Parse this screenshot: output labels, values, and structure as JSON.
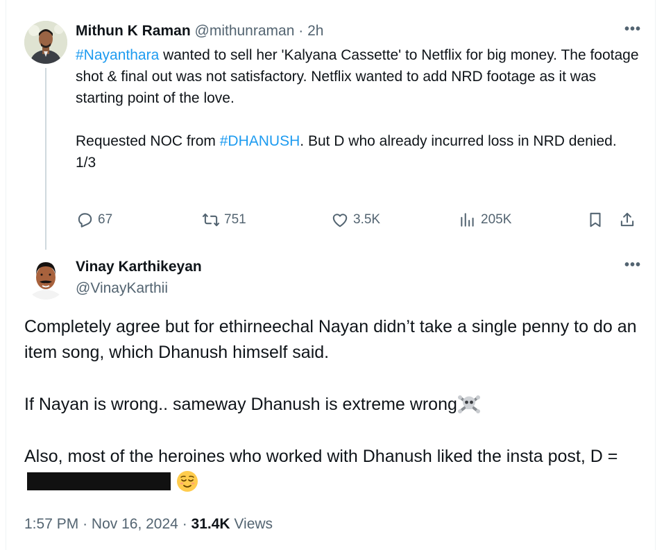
{
  "parent_tweet": {
    "author_name": "Mithun K Raman",
    "author_handle": "@mithunraman",
    "separator": "·",
    "time_ago": "2h",
    "more_label": "•••",
    "line1_hashtag": "#Nayanthara",
    "line1_text": " wanted to sell her 'Kalyana Cassette' to Netflix for big money. The footage shot & final out was not satisfactory. Netflix wanted to add NRD footage as it was starting point of the love.",
    "line2_prefix": "Requested NOC from ",
    "line2_hashtag": "#DHANUSH",
    "line2_text": ". But D who already incurred loss in NRD denied.",
    "line3_text": "1/3",
    "actions": {
      "replies": "67",
      "reposts": "751",
      "likes": "3.5K",
      "views": "205K"
    }
  },
  "main_tweet": {
    "author_name": "Vinay Karthikeyan",
    "author_handle": "@VinayKarthii",
    "more_label": "•••",
    "para1": "Completely agree but for ethirneechal Nayan didn’t take a single penny to do an item song, which Dhanush himself said.",
    "para2": "If Nayan is wrong.. sameway Dhanush is extreme wrong",
    "para2_emoji": "skull-and-crossbones",
    "para3": "Also, most of the heroines who worked with Dhanush liked the insta post, D =",
    "para3_emoji": "relieved-face",
    "time": "1:57 PM",
    "dot": "·",
    "date": "Nov 16, 2024",
    "views_count": "31.4K",
    "views_label": " Views"
  },
  "colors": {
    "link": "#1d9bf0",
    "muted": "#536471",
    "text": "#0f1419",
    "thread_line": "#cfd9de"
  }
}
